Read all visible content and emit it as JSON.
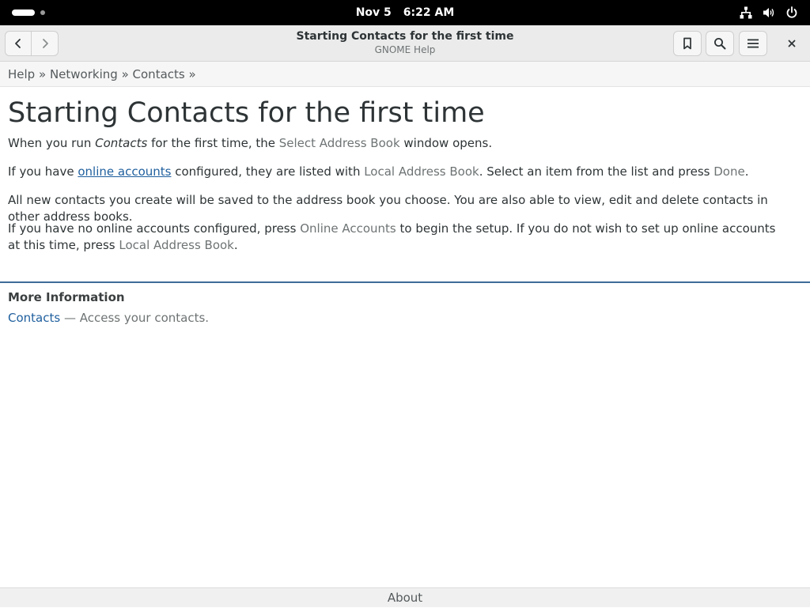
{
  "system": {
    "date": "Nov 5",
    "time": "6:22 AM",
    "icons": [
      "network-icon",
      "volume-icon",
      "power-icon"
    ]
  },
  "window": {
    "title": "Starting Contacts for the first time",
    "subtitle": "GNOME Help"
  },
  "breadcrumb": {
    "items": [
      "Help",
      "Networking",
      "Contacts"
    ],
    "separator": "»"
  },
  "page": {
    "heading": "Starting Contacts for the first time",
    "p1": {
      "a": "When you run ",
      "app": "Contacts",
      "b": " for the first time, the ",
      "gui": "Select Address Book",
      "c": " window opens."
    },
    "p2": {
      "a": "If you have ",
      "link": "online accounts",
      "b": " configured, they are listed with ",
      "gui1": "Local Address Book",
      "c": ". Select an item from the list and press ",
      "gui2": "Done",
      "d": "."
    },
    "p3": "All new contacts you create will be saved to the address book you choose. You are also able to view, edit and delete contacts in other address books.",
    "p4": {
      "a": "If you have no online accounts configured, press ",
      "gui1": "Online Accounts",
      "b": " to begin the setup. If you do not wish to set up online accounts at this time, press ",
      "gui2": "Local Address Book",
      "c": "."
    }
  },
  "more_info": {
    "heading": "More Information",
    "link": "Contacts",
    "description": " — Access your contacts."
  },
  "footer": {
    "about": "About"
  },
  "colors": {
    "link": "#1f5f9e",
    "divider": "#3e6c98",
    "topbar": "#000000"
  }
}
